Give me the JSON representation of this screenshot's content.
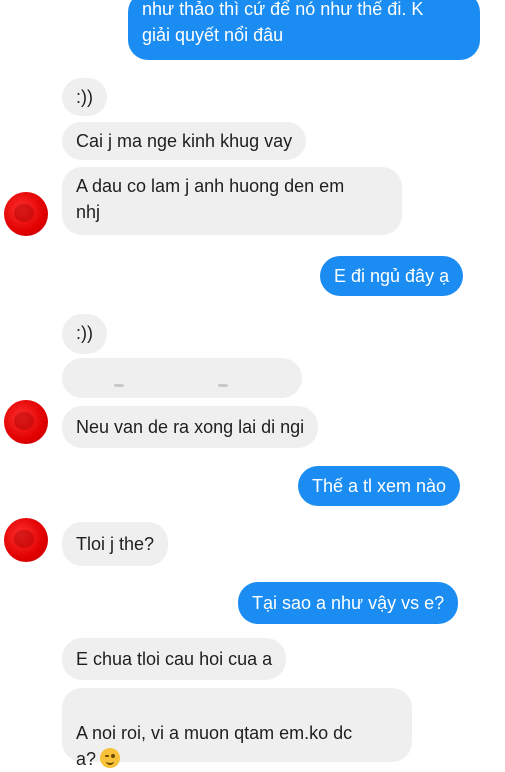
{
  "conversation": {
    "messages": [
      {
        "from": "me",
        "text": "như thảo thì cứ để nó như thế đi. K\ngiải quyết nổi đâu"
      },
      {
        "from": "them",
        "text": ":))"
      },
      {
        "from": "them",
        "text": "Cai j ma nge kinh khug vay"
      },
      {
        "from": "them",
        "text": "A dau co lam j anh huong den em\nnhj"
      },
      {
        "from": "me",
        "text": "E đi ngủ đây ạ"
      },
      {
        "from": "them",
        "text": ":))"
      },
      {
        "from": "them",
        "text": ""
      },
      {
        "from": "them",
        "text": "Neu van de ra xong lai di ngi"
      },
      {
        "from": "me",
        "text": "Thế a tl xem nào"
      },
      {
        "from": "them",
        "text": "Tloi j the?"
      },
      {
        "from": "me",
        "text": "Tại sao a như vậy vs e?"
      },
      {
        "from": "them",
        "text": "E chua tloi cau hoi cua a"
      },
      {
        "from": "them",
        "text": "A noi roi, vi a muon qtam em.ko dc\na?"
      }
    ]
  },
  "icons": {
    "avatar": "red-censored-avatar",
    "emoji": "winking-face-emoji"
  },
  "colors": {
    "outgoing_bubble": "#1a8cf2",
    "incoming_bubble": "#efefef",
    "avatar_censor": "#e00000"
  }
}
